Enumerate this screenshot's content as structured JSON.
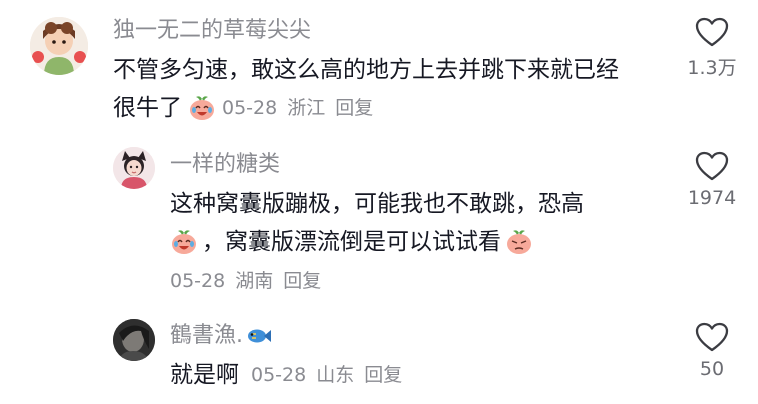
{
  "comments": [
    {
      "username": "独一无二的草莓尖尖",
      "line1": "不管多匀速，敢这么高的地方上去并跳下来就已经",
      "line2": "很牛了",
      "date": "05-28",
      "location": "浙江",
      "reply": "回复",
      "likes": "1.3万",
      "avatar_icon": "strawberry-girl-avatar"
    },
    {
      "username": "一样的糖类",
      "line1": "这种窝囊版蹦极，可能我也不敢跳，恐高",
      "line2": "，窝囊版漂流倒是可以试试看",
      "date": "05-28",
      "location": "湖南",
      "reply": "回复",
      "likes": "1974",
      "avatar_icon": "girl-cat-ears-avatar"
    },
    {
      "username": "鶴書漁.",
      "line1": "就是啊",
      "date": "05-28",
      "location": "山东",
      "reply": "回复",
      "likes": "50",
      "avatar_icon": "dark-portrait-avatar"
    }
  ],
  "colors": {
    "username": "#8a8b91",
    "text": "#161823",
    "meta": "#8a8b91",
    "heart_stroke": "#3b3c42"
  }
}
